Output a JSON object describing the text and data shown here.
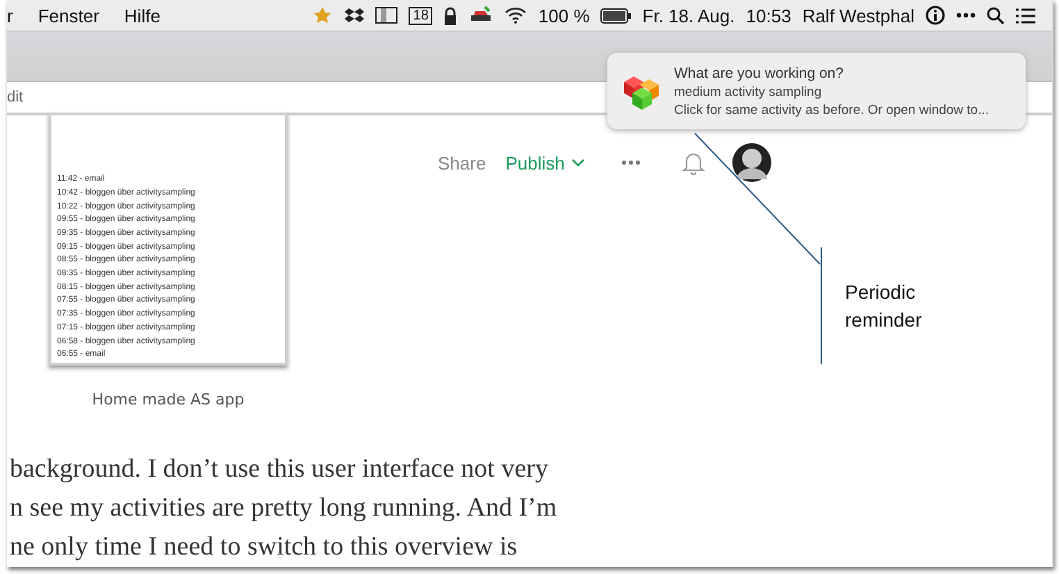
{
  "menubar": {
    "menus": [
      "r",
      "Fenster",
      "Hilfe"
    ],
    "calendar_day": "18",
    "battery": "100 %",
    "date": "Fr. 18. Aug.",
    "time": "10:53",
    "user": "Ralf Westphal"
  },
  "address_bar": {
    "value": "dit"
  },
  "toolbar": {
    "share": "Share",
    "publish": "Publish"
  },
  "screenshot": {
    "rows": [
      "11:42 - email",
      "10:42 - bloggen über activitysampling",
      "10:22 - bloggen über activitysampling",
      "09:55 - bloggen über activitysampling",
      "09:35 - bloggen über activitysampling",
      "09:15 - bloggen über activitysampling",
      "08:55 - bloggen über activitysampling",
      "08:35 - bloggen über activitysampling",
      "08:15 - bloggen über activitysampling",
      "07:55 - bloggen über activitysampling",
      "07:35 - bloggen über activitysampling",
      "07:15 - bloggen über activitysampling",
      "06:58 - bloggen über activitysampling",
      "06:55 - email"
    ],
    "caption": "Home made AS app"
  },
  "article_lines": [
    "background. I don’t use this user interface not very",
    "n see my activities are pretty long running. And I’m",
    "ne only time I need to switch to this overview is"
  ],
  "notification": {
    "title": "What are you working on?",
    "subtitle": "medium activity sampling",
    "body": "Click for same activity as before. Or open window to..."
  },
  "annotation": "Periodic reminder"
}
